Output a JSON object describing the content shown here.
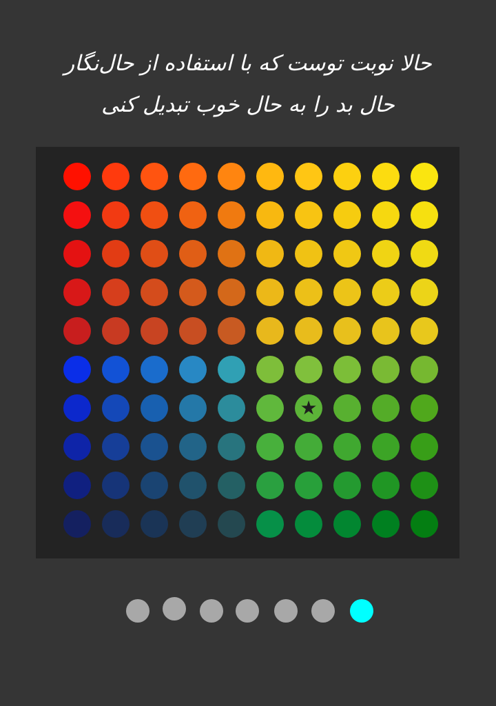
{
  "title": {
    "line1": "حالا نوبت توست که با استفاده از حال‌نگار",
    "line2": "حال بد را به حال خوب تبدیل کنی"
  },
  "grid": {
    "rows": [
      [
        "#ff1100",
        "#ff3a0d",
        "#ff5410",
        "#ff6a10",
        "#ff8510",
        "#ffb810",
        "#ffc614",
        "#fcd010",
        "#fcdc10",
        "#fae510"
      ],
      [
        "#f41010",
        "#f23a12",
        "#f04f12",
        "#f06212",
        "#f07a10",
        "#f8b810",
        "#f8c412",
        "#f6cc10",
        "#f6d810",
        "#f6e010"
      ],
      [
        "#e41212",
        "#e23c14",
        "#e04e16",
        "#e05e16",
        "#e07214",
        "#f0b814",
        "#f0c214",
        "#f0c814",
        "#f0d414",
        "#f0da14"
      ],
      [
        "#d81818",
        "#d63e1c",
        "#d44c1c",
        "#d45a1c",
        "#d4681a",
        "#ecb818",
        "#ecc018",
        "#ecc418",
        "#eccc18",
        "#ecd418"
      ],
      [
        "#c81e1e",
        "#c83a22",
        "#c84422",
        "#c84e22",
        "#c85a22",
        "#e8b81c",
        "#e8bc1c",
        "#e8c01c",
        "#e8c41c",
        "#e8c81c"
      ],
      [
        "#0a2ee8",
        "#1252d6",
        "#1a6ccc",
        "#2888c4",
        "#30a0b4",
        "#7ebe3a",
        "#80c03c",
        "#7cbe38",
        "#7aba34",
        "#76b830"
      ],
      [
        "#0c28cc",
        "#1448b8",
        "#1860b0",
        "#2478a8",
        "#2c8c9c",
        "#60b83c",
        "#5cb438",
        "#58b030",
        "#54ac28",
        "#50a81c"
      ],
      [
        "#0e24a8",
        "#163e98",
        "#1a5290",
        "#226488",
        "#28747e",
        "#48b03c",
        "#44ac38",
        "#40a830",
        "#3ca426",
        "#389e18"
      ],
      [
        "#102080",
        "#163478",
        "#1a4472",
        "#20526c",
        "#246064",
        "#2aa040",
        "#28a03a",
        "#249a30",
        "#209624",
        "#1e9016"
      ],
      [
        "#142060",
        "#182c5a",
        "#1a3456",
        "#203e54",
        "#244850",
        "#069048",
        "#048c3c",
        "#028630",
        "#008020",
        "#047e12"
      ]
    ],
    "star_cell": {
      "row": 6,
      "col": 6,
      "icon": "star-icon",
      "glyph": "★"
    }
  },
  "pager": {
    "count": 7,
    "active_index": 6,
    "dot_color": "#a8a8a8",
    "active_color": "#00ffff"
  }
}
